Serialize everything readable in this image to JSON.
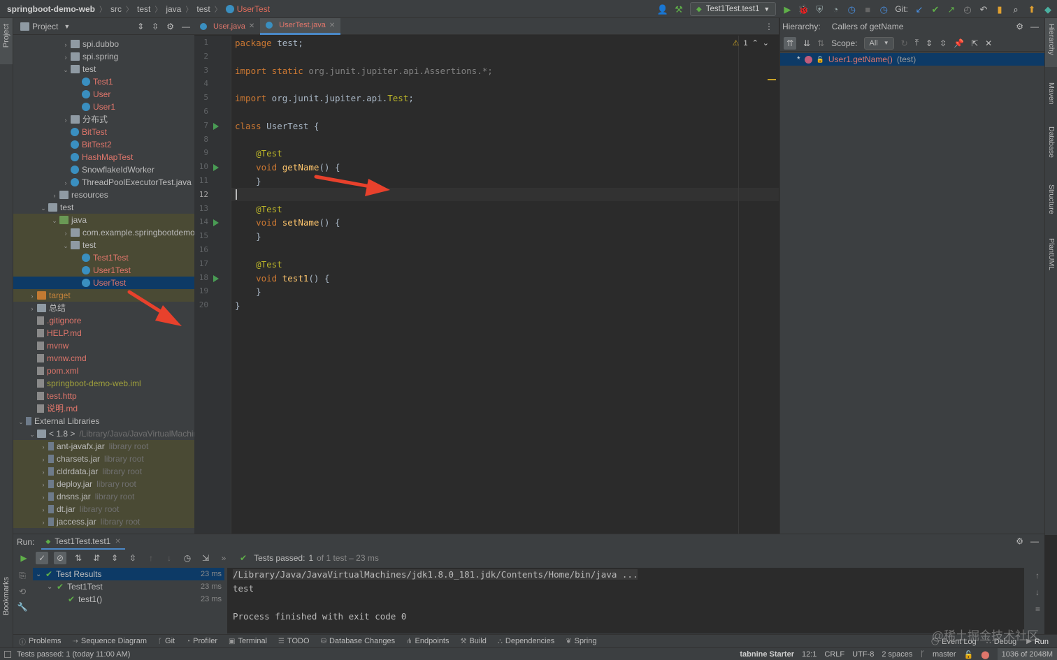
{
  "breadcrumb": [
    "springboot-demo-web",
    "src",
    "test",
    "java",
    "test",
    "UserTest"
  ],
  "toolbar": {
    "run_config": "Test1Test.test1",
    "git_label": "Git:"
  },
  "project_panel": {
    "title": "Project",
    "tree": [
      {
        "label": "spi.dubbo",
        "kind": "folder",
        "arrow": "›",
        "color": "",
        "hl": false
      },
      {
        "label": "spi.spring",
        "kind": "folder",
        "arrow": "›",
        "color": "",
        "hl": false
      },
      {
        "label": "test",
        "kind": "folder",
        "arrow": "⌄",
        "color": "",
        "hl": false
      },
      {
        "label": "Test1",
        "kind": "class",
        "arrow": "",
        "color": "red",
        "hl": false
      },
      {
        "label": "User",
        "kind": "class",
        "arrow": "",
        "color": "red",
        "hl": false
      },
      {
        "label": "User1",
        "kind": "class",
        "arrow": "",
        "color": "red",
        "hl": false
      },
      {
        "label": "分布式",
        "kind": "folder",
        "arrow": "›",
        "color": "",
        "hl": false
      },
      {
        "label": "BitTest",
        "kind": "class",
        "arrow": "",
        "color": "red",
        "hl": false
      },
      {
        "label": "BitTest2",
        "kind": "class",
        "arrow": "",
        "color": "red",
        "hl": false
      },
      {
        "label": "HashMapTest",
        "kind": "class",
        "arrow": "",
        "color": "red",
        "hl": false
      },
      {
        "label": "SnowflakeIdWorker",
        "kind": "class",
        "arrow": "",
        "color": "",
        "hl": false
      },
      {
        "label": "ThreadPoolExecutorTest.java",
        "kind": "class",
        "arrow": "›",
        "color": "",
        "hl": false
      },
      {
        "label": "resources",
        "kind": "folder",
        "arrow": "›",
        "color": "",
        "hl": false
      },
      {
        "label": "test",
        "kind": "folder",
        "arrow": "⌄",
        "color": "",
        "hl": false
      },
      {
        "label": "java",
        "kind": "folder-g",
        "arrow": "⌄",
        "color": "",
        "hl": true
      },
      {
        "label": "com.example.springbootdemo",
        "kind": "folder",
        "arrow": "›",
        "color": "",
        "hl": true
      },
      {
        "label": "test",
        "kind": "folder",
        "arrow": "⌄",
        "color": "",
        "hl": true
      },
      {
        "label": "Test1Test",
        "kind": "class",
        "arrow": "",
        "color": "red",
        "hl": true
      },
      {
        "label": "User1Test",
        "kind": "class",
        "arrow": "",
        "color": "red",
        "hl": true
      },
      {
        "label": "UserTest",
        "kind": "class",
        "arrow": "",
        "color": "red",
        "hl": false,
        "sel": true
      },
      {
        "label": "target",
        "kind": "folder-o",
        "arrow": "›",
        "color": "orange",
        "hl": true
      },
      {
        "label": "总结",
        "kind": "folder",
        "arrow": "›",
        "color": "",
        "hl": false
      },
      {
        "label": ".gitignore",
        "kind": "file",
        "arrow": "",
        "color": "red",
        "hl": false
      },
      {
        "label": "HELP.md",
        "kind": "file",
        "arrow": "",
        "color": "red",
        "hl": false
      },
      {
        "label": "mvnw",
        "kind": "file",
        "arrow": "",
        "color": "red",
        "hl": false
      },
      {
        "label": "mvnw.cmd",
        "kind": "file",
        "arrow": "",
        "color": "red",
        "hl": false
      },
      {
        "label": "pom.xml",
        "kind": "file",
        "arrow": "",
        "color": "red",
        "hl": false
      },
      {
        "label": "springboot-demo-web.iml",
        "kind": "file",
        "arrow": "",
        "color": "olive",
        "hl": false
      },
      {
        "label": "test.http",
        "kind": "file",
        "arrow": "",
        "color": "red",
        "hl": false
      },
      {
        "label": "说明.md",
        "kind": "file",
        "arrow": "",
        "color": "red",
        "hl": false
      },
      {
        "label": "External Libraries",
        "kind": "lib",
        "arrow": "⌄",
        "color": "",
        "hl": false
      },
      {
        "label": "< 1.8 >",
        "suffix": "/Library/Java/JavaVirtualMachines",
        "kind": "folder",
        "arrow": "⌄",
        "color": "",
        "hl": false
      },
      {
        "label": "ant-javafx.jar",
        "suffix": "library root",
        "kind": "lib",
        "arrow": "›",
        "color": "",
        "hl": true
      },
      {
        "label": "charsets.jar",
        "suffix": "library root",
        "kind": "lib",
        "arrow": "›",
        "color": "",
        "hl": true
      },
      {
        "label": "cldrdata.jar",
        "suffix": "library root",
        "kind": "lib",
        "arrow": "›",
        "color": "",
        "hl": true
      },
      {
        "label": "deploy.jar",
        "suffix": "library root",
        "kind": "lib",
        "arrow": "›",
        "color": "",
        "hl": true
      },
      {
        "label": "dnsns.jar",
        "suffix": "library root",
        "kind": "lib",
        "arrow": "›",
        "color": "",
        "hl": true
      },
      {
        "label": "dt.jar",
        "suffix": "library root",
        "kind": "lib",
        "arrow": "›",
        "color": "",
        "hl": true
      },
      {
        "label": "jaccess.jar",
        "suffix": "library root",
        "kind": "lib",
        "arrow": "›",
        "color": "",
        "hl": true
      }
    ]
  },
  "editor": {
    "tabs": [
      {
        "label": "User.java",
        "active": false
      },
      {
        "label": "UserTest.java",
        "active": true
      }
    ],
    "warning_count": "1",
    "lines": [
      {
        "n": "1",
        "html": "<span class='kw'>package</span> test;"
      },
      {
        "n": "2",
        "html": ""
      },
      {
        "n": "3",
        "html": "<span class='kw'>import static</span> <span class='cm'>org.junit.jupiter.api.Assertions.*;</span>"
      },
      {
        "n": "4",
        "html": ""
      },
      {
        "n": "5",
        "html": "<span class='kw'>import</span> org.junit.jupiter.api.<span class='an'>Test</span>;"
      },
      {
        "n": "6",
        "html": ""
      },
      {
        "n": "7",
        "html": "<span class='kw'>class</span> UserTest {"
      },
      {
        "n": "8",
        "html": ""
      },
      {
        "n": "9",
        "html": "    <span class='an'>@Test</span>"
      },
      {
        "n": "10",
        "html": "    <span class='kw'>void</span> <span class='fn'>getName</span>() {"
      },
      {
        "n": "11",
        "html": "    }"
      },
      {
        "n": "12",
        "html": ""
      },
      {
        "n": "13",
        "html": "    <span class='an'>@Test</span>"
      },
      {
        "n": "14",
        "html": "    <span class='kw'>void</span> <span class='fn'>setName</span>() {"
      },
      {
        "n": "15",
        "html": "    }"
      },
      {
        "n": "16",
        "html": ""
      },
      {
        "n": "17",
        "html": "    <span class='an'>@Test</span>"
      },
      {
        "n": "18",
        "html": "    <span class='kw'>void</span> <span class='fn'>test1</span>() {"
      },
      {
        "n": "19",
        "html": "    }"
      },
      {
        "n": "20",
        "html": "}"
      }
    ],
    "run_marks": [
      "7",
      "10",
      "14",
      "18"
    ],
    "current_line": "12"
  },
  "hierarchy": {
    "title": "Hierarchy:",
    "subtitle": "Callers of getName",
    "scope_label": "Scope:",
    "scope_value": "All",
    "row_method": "User1.getName()",
    "row_package": "(test)"
  },
  "run_panel": {
    "label": "Run:",
    "tab": "Test1Test.test1",
    "status_prefix": "Tests passed:",
    "status_count": "1",
    "status_rest": "of 1 test – 23 ms",
    "results": [
      {
        "label": "Test Results",
        "time": "23 ms",
        "indent": 0,
        "sel": true
      },
      {
        "label": "Test1Test",
        "time": "23 ms",
        "indent": 1,
        "sel": false
      },
      {
        "label": "test1()",
        "time": "23 ms",
        "indent": 2,
        "sel": false
      }
    ],
    "console": [
      "/Library/Java/JavaVirtualMachines/jdk1.8.0_181.jdk/Contents/Home/bin/java ...",
      "test",
      "",
      "Process finished with exit code 0"
    ]
  },
  "tool_windows": [
    "Problems",
    "Sequence Diagram",
    "Git",
    "Profiler",
    "Terminal",
    "TODO",
    "Database Changes",
    "Endpoints",
    "Build",
    "Dependencies",
    "Spring"
  ],
  "tool_windows_right": [
    "Event Log",
    "Debug",
    "Run"
  ],
  "right_stripe": [
    "Hierarchy",
    "Maven",
    "Database",
    "Structure",
    "PlantUML"
  ],
  "left_stripe": [
    "Project",
    "Bookmarks"
  ],
  "status": {
    "message": "Tests passed: 1 (today 11:00 AM)",
    "tabnine": "tabnine Starter",
    "position": "12:1",
    "line_sep": "CRLF",
    "encoding": "UTF-8",
    "indent": "2 spaces",
    "branch": "master",
    "memory": "1036 of 2048M"
  },
  "watermark": "@稀土掘金技术社区"
}
